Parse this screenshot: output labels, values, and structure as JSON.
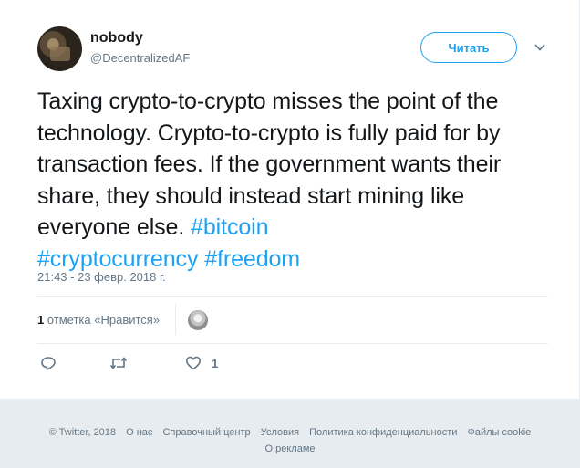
{
  "user": {
    "name": "nobody",
    "handle": "@DecentralizedAF"
  },
  "follow_button": {
    "label": "Читать"
  },
  "tweet": {
    "text": "Taxing crypto-to-crypto misses the point of the technology. Crypto-to-crypto is fully paid for by transaction fees. If the government wants their share, they should instead start mining like everyone else. ",
    "hashtags": [
      "#bitcoin",
      "#cryptocurrency",
      "#freedom"
    ],
    "timestamp": "21:43 - 23 февр. 2018 г."
  },
  "stats": {
    "likes_count": "1",
    "likes_label": " отметка «Нравится»"
  },
  "actions": {
    "like_count": "1"
  },
  "footer": {
    "links": [
      "© Twitter, 2018",
      "О нас",
      "Справочный центр",
      "Условия",
      "Политика конфиденциальности",
      "Файлы cookie"
    ],
    "second_line": "О рекламе"
  },
  "colors": {
    "accent": "#1da1f2",
    "secondary_text": "#657786",
    "background": "#e6ecf0"
  },
  "icons": [
    "chevron-down-icon",
    "reply-icon",
    "retweet-icon",
    "heart-icon"
  ]
}
